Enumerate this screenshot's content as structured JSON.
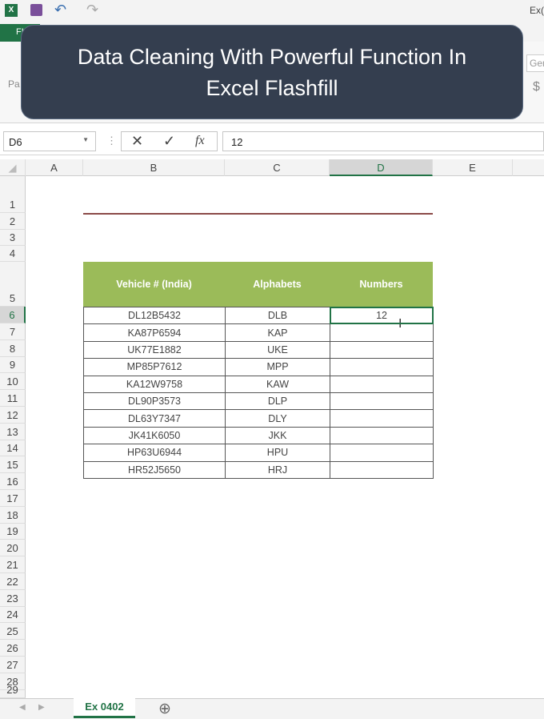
{
  "quick_access": {
    "app_icon": "excel-icon",
    "save_icon": "save-icon",
    "undo_icon": "undo-icon",
    "redo_icon": "redo-icon",
    "title_partial": "Ex("
  },
  "ribbon": {
    "file_tab": "FI",
    "paste_label": "Pa",
    "number_format": "Gen",
    "currency": "$"
  },
  "banner": {
    "line1": "Data Cleaning With Powerful Function In",
    "line2": "Excel Flashfill"
  },
  "formula_bar": {
    "name_box": "D6",
    "cancel": "✕",
    "enter": "✓",
    "fx": "fx",
    "value": "12"
  },
  "columns": [
    "A",
    "B",
    "C",
    "D",
    "E"
  ],
  "rows": [
    "1",
    "2",
    "3",
    "4",
    "5",
    "6",
    "7",
    "8",
    "9",
    "10",
    "11",
    "12",
    "13",
    "14",
    "15",
    "16",
    "17",
    "18",
    "19",
    "20",
    "21",
    "22",
    "23",
    "24",
    "25",
    "26",
    "27",
    "28",
    "29"
  ],
  "table": {
    "headers": [
      "Vehicle # (India)",
      "Alphabets",
      "Numbers"
    ],
    "rows": [
      [
        "DL12B5432",
        "DLB",
        "12"
      ],
      [
        "KA87P6594",
        "KAP",
        ""
      ],
      [
        "UK77E1882",
        "UKE",
        ""
      ],
      [
        "MP85P7612",
        "MPP",
        ""
      ],
      [
        "KA12W9758",
        "KAW",
        ""
      ],
      [
        "DL90P3573",
        "DLP",
        ""
      ],
      [
        "DL63Y7347",
        "DLY",
        ""
      ],
      [
        "JK41K6050",
        "JKK",
        ""
      ],
      [
        "HP63U6944",
        "HPU",
        ""
      ],
      [
        "HR52J5650",
        "HRJ",
        ""
      ]
    ],
    "header_color": "#9bbb59"
  },
  "sheet_tabs": {
    "active": "Ex 0402",
    "add": "⊕"
  },
  "accent": "#217346"
}
